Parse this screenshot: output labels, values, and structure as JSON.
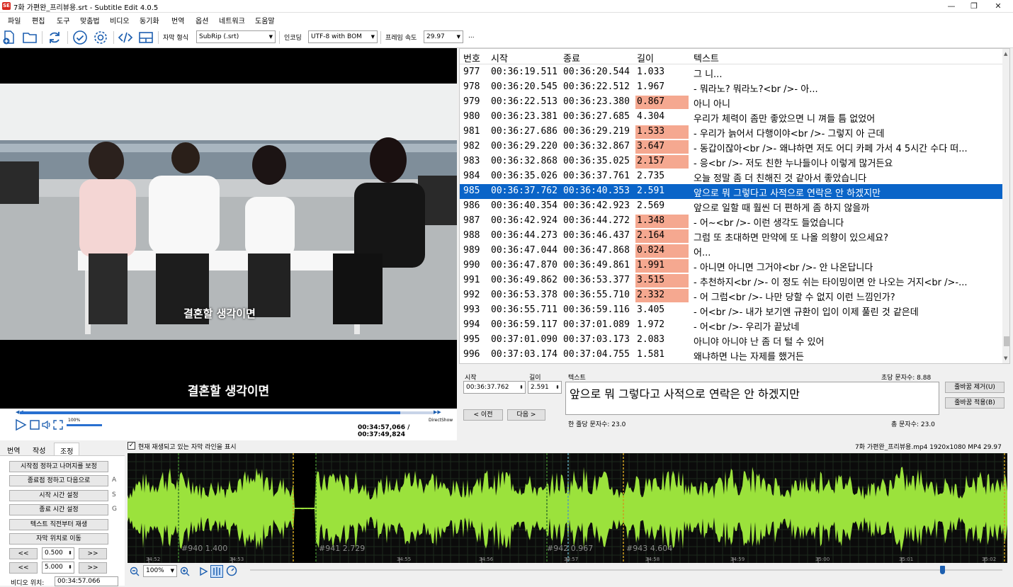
{
  "window": {
    "title": "7화 가편완_프리뷰용.srt - Subtitle Edit 4.0.5",
    "minimize": "—",
    "maximize": "❐",
    "close": "✕"
  },
  "menu": [
    "파일",
    "편집",
    "도구",
    "맞춤법",
    "비디오",
    "동기화",
    "번역",
    "옵션",
    "네트워크",
    "도움말"
  ],
  "toolbar": {
    "icons": [
      "new-file",
      "open-folder",
      "refresh",
      "check",
      "settings",
      "source-view",
      "layout"
    ],
    "format_label": "자막 형식",
    "format_value": "SubRip (.srt)",
    "encoding_label": "인코딩",
    "encoding_value": "UTF-8 with BOM",
    "fps_label": "프레임 속도",
    "fps_value": "29.97",
    "more": "..."
  },
  "video": {
    "burned_subtitle": "결혼할 생각이면",
    "overlay_subtitle": "결혼할 생각이면",
    "volume_pct": "100%",
    "renderer": "DirectShow",
    "time_display": "00:34:57,066 / 00:37:49,824",
    "progress_fraction": 0.92
  },
  "grid": {
    "headers": {
      "num": "번호",
      "start": "시작",
      "end": "종료",
      "dur": "길이",
      "text": "텍스트"
    },
    "rows": [
      {
        "num": "977",
        "start": "00:36:19.511",
        "end": "00:36:20.544",
        "dur": "1.033",
        "text": "그 니...",
        "hl": false
      },
      {
        "num": "978",
        "start": "00:36:20.545",
        "end": "00:36:22.512",
        "dur": "1.967",
        "text": "- 뭐라노? 뭐라노?<br />- 아...",
        "hl": false
      },
      {
        "num": "979",
        "start": "00:36:22.513",
        "end": "00:36:23.380",
        "dur": "0.867",
        "text": "아니 아니",
        "hl": true
      },
      {
        "num": "980",
        "start": "00:36:23.381",
        "end": "00:36:27.685",
        "dur": "4.304",
        "text": "우리가 체력이 좀만 좋았으면 니 껴들 틈 없었어",
        "hl": false
      },
      {
        "num": "981",
        "start": "00:36:27.686",
        "end": "00:36:29.219",
        "dur": "1.533",
        "text": "- 우리가 늙어서 다행이야<br />- 그렇지 아 근데",
        "hl": true
      },
      {
        "num": "982",
        "start": "00:36:29.220",
        "end": "00:36:32.867",
        "dur": "3.647",
        "text": "- 동갑이잖아<br />- 왜냐하면 저도 어디 카페 가서 4 5시간 수다 떠...",
        "hl": true
      },
      {
        "num": "983",
        "start": "00:36:32.868",
        "end": "00:36:35.025",
        "dur": "2.157",
        "text": "- 응<br />- 저도 친한 누나들이나 이렇게 많거든요",
        "hl": true
      },
      {
        "num": "984",
        "start": "00:36:35.026",
        "end": "00:36:37.761",
        "dur": "2.735",
        "text": "오늘 정말 좀 더 친해진 것 같아서 좋았습니다",
        "hl": false
      },
      {
        "num": "985",
        "start": "00:36:37.762",
        "end": "00:36:40.353",
        "dur": "2.591",
        "text": "앞으로 뭐 그렇다고 사적으로 연락은 안 하겠지만",
        "hl": false,
        "selected": true
      },
      {
        "num": "986",
        "start": "00:36:40.354",
        "end": "00:36:42.923",
        "dur": "2.569",
        "text": "앞으로 일할 때 훨씬 더 편하게 좀 하지 않을까",
        "hl": false
      },
      {
        "num": "987",
        "start": "00:36:42.924",
        "end": "00:36:44.272",
        "dur": "1.348",
        "text": "- 어~<br />- 이런 생각도 들었습니다",
        "hl": true
      },
      {
        "num": "988",
        "start": "00:36:44.273",
        "end": "00:36:46.437",
        "dur": "2.164",
        "text": "그럼 또 초대하면 만약에 또 나올 의향이 있으세요?",
        "hl": true
      },
      {
        "num": "989",
        "start": "00:36:47.044",
        "end": "00:36:47.868",
        "dur": "0.824",
        "text": "어...",
        "hl": true
      },
      {
        "num": "990",
        "start": "00:36:47.870",
        "end": "00:36:49.861",
        "dur": "1.991",
        "text": "- 아니면 아니면 그거야<br />- 안 나온답니다",
        "hl": true
      },
      {
        "num": "991",
        "start": "00:36:49.862",
        "end": "00:36:53.377",
        "dur": "3.515",
        "text": "- 추천하지<br />- 이 정도 쉬는 타이밍이면 안 나오는 거지<br />-...",
        "hl": true
      },
      {
        "num": "992",
        "start": "00:36:53.378",
        "end": "00:36:55.710",
        "dur": "2.332",
        "text": "- 어 그럼<br />- 나만 당할 수 없지 이런 느낌인가?",
        "hl": true
      },
      {
        "num": "993",
        "start": "00:36:55.711",
        "end": "00:36:59.116",
        "dur": "3.405",
        "text": "- 어<br />- 내가 보기엔 규환이 입이 이제 풀린 것 같은데",
        "hl": false
      },
      {
        "num": "994",
        "start": "00:36:59.117",
        "end": "00:37:01.089",
        "dur": "1.972",
        "text": "- 어<br />- 우리가 끝났네",
        "hl": false
      },
      {
        "num": "995",
        "start": "00:37:01.090",
        "end": "00:37:03.173",
        "dur": "2.083",
        "text": "아니야 아니야 난 좀 더 털 수 있어",
        "hl": false
      },
      {
        "num": "996",
        "start": "00:37:03.174",
        "end": "00:37:04.755",
        "dur": "1.581",
        "text": "왜냐하면 나는 자제를 했거든",
        "hl": false
      }
    ]
  },
  "editor": {
    "start_label": "시작",
    "start_value": "00:36:37.762",
    "dur_label": "길이",
    "dur_value": "2.591",
    "text_label": "텍스트",
    "cps": "초당 문자수: 8.88",
    "text_value": "앞으로 뭐 그렇다고 사적으로 연락은 안 하겠지만",
    "prev": "< 이전",
    "next": "다음 >",
    "line_chars": "한 줄당 문자수: 23.0",
    "total_chars": "총 문자수: 23.0",
    "remove_breaks": "줄바꿈 제거(U)",
    "apply_breaks": "줄바꿈 적용(B)"
  },
  "tabs": {
    "items": [
      "번역",
      "작성",
      "조정"
    ],
    "active": "조정"
  },
  "adjust": {
    "buttons": [
      {
        "label": "시작점 정하고 나머지를 보정",
        "key": ""
      },
      {
        "label": "종료점 정하고 다음으로",
        "key": "A"
      },
      {
        "label": "시작 시간 설정",
        "key": "S"
      },
      {
        "label": "종료 시간 설정",
        "key": "G"
      },
      {
        "label": "텍스트 직전부터 재생",
        "key": ""
      },
      {
        "label": "자막 위치로 이동",
        "key": ""
      }
    ],
    "step1": "0.500",
    "step2": "5.000",
    "back": "<<",
    "fwd": ">>",
    "video_pos_label": "비디오 위치:",
    "video_pos_value": "00:34:57.066"
  },
  "waveform": {
    "show_line_label": "현재 재생되고 있는 자막 라인을 표시",
    "file_info": "7화 가편완_프리뷰용.mp4 1920x1080 MP4 29.97",
    "ticks": [
      "34:52",
      "34:53",
      "34:55",
      "34:56",
      "34:57",
      "34:58",
      "34:59",
      "35:00",
      "35:01",
      "35:02"
    ],
    "markers": [
      "#940  1.400",
      "#941  2.729",
      "#942  0.967",
      "#943  4.604"
    ],
    "zoom": "100%"
  },
  "colors": {
    "selection": "#0a64c8",
    "duration_warning": "#f5a890",
    "wave": "#9be23c",
    "accent": "#1d5fb0"
  }
}
